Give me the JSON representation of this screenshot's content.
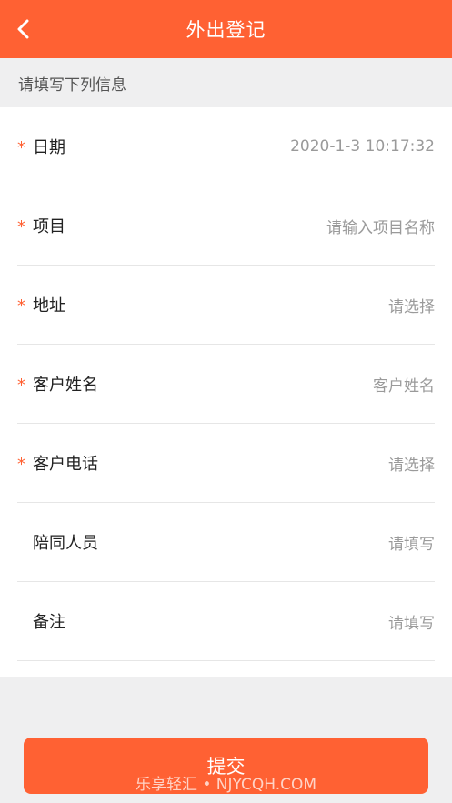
{
  "header": {
    "title": "外出登记",
    "back_icon": "chevron-left-icon",
    "background": "#ff6133"
  },
  "section": {
    "label": "请填写下列信息"
  },
  "form": {
    "rows": [
      {
        "required": "*",
        "label": "日期",
        "value": "2020-1-3 10:17:32"
      },
      {
        "required": "*",
        "label": "项目",
        "value": "请输入项目名称"
      },
      {
        "required": "*",
        "label": "地址",
        "value": "请选择"
      },
      {
        "required": "*",
        "label": "客户姓名",
        "value": "客户姓名"
      },
      {
        "required": "*",
        "label": "客户电话",
        "value": "请选择"
      },
      {
        "required": "",
        "label": "陪同人员",
        "value": "请填写"
      },
      {
        "required": "",
        "label": "备注",
        "value": "请填写"
      }
    ]
  },
  "submit": {
    "label": "提交"
  },
  "watermark": {
    "text": "乐享轻汇 • NJYCQH.COM"
  },
  "colors": {
    "accent": "#ff6133",
    "required": "#ff6133",
    "placeholder": "#9a9a9a"
  }
}
